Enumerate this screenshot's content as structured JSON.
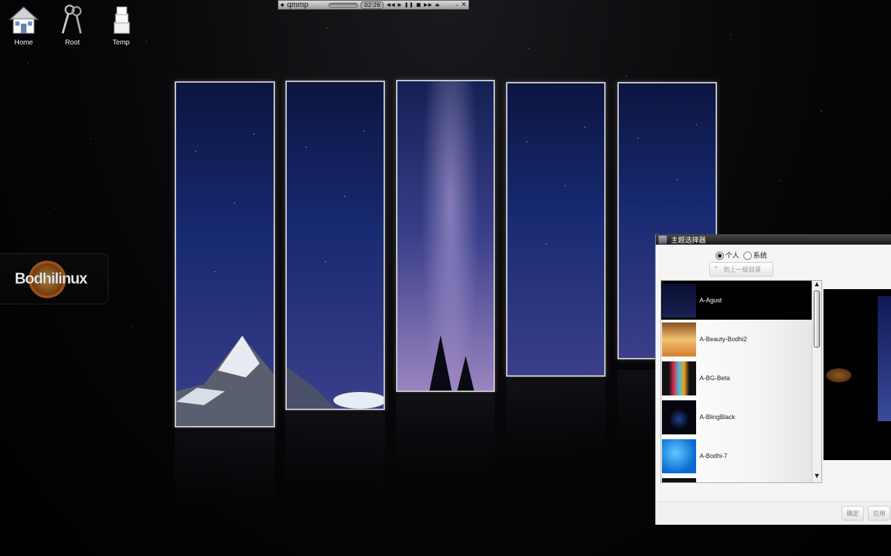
{
  "desktop": {
    "icons": [
      {
        "label": "Home"
      },
      {
        "label": "Root"
      },
      {
        "label": "Temp"
      }
    ],
    "logo_text": "Bodhilinux"
  },
  "qmmp": {
    "title": "qmmp",
    "time": "02:26",
    "controls": "◀◀ ▶ ❚❚ ■ ▶▶ ⏏"
  },
  "theme_window": {
    "title": "主题选择器",
    "radio_personal": "个人",
    "radio_system": "系统",
    "up_button": "到上一级目录",
    "themes": [
      {
        "name": "A-Agust",
        "selected": true,
        "thumb_color": "#0a1030"
      },
      {
        "name": "A-Beauty-Bodhi2",
        "selected": false,
        "thumb_color": "#d9a055"
      },
      {
        "name": "A-BG-Beta",
        "selected": false,
        "thumb_color": "#111"
      },
      {
        "name": "A-BlingBlack",
        "selected": false,
        "thumb_color": "#050510"
      },
      {
        "name": "A-Bodhi-7",
        "selected": false,
        "thumb_color": "#1a8ae0"
      }
    ],
    "ok_button": "确定",
    "apply_button": "应用"
  }
}
